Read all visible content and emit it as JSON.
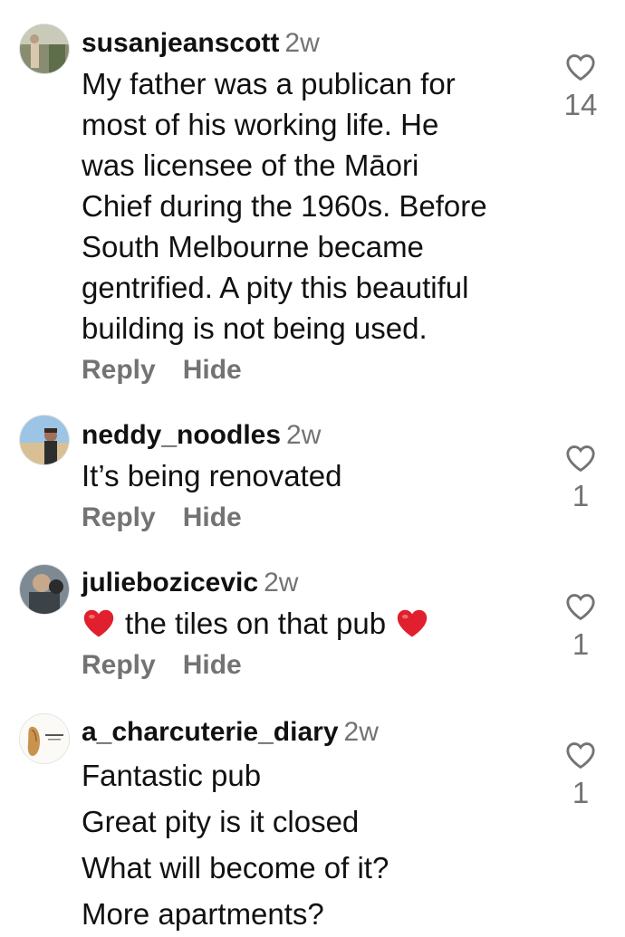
{
  "comments": [
    {
      "username": "susanjeanscott",
      "time": "2w",
      "lines": [
        "My father was a publican for",
        "most of his working life. He",
        "was licensee of the Māori",
        "Chief during the 1960s. Before",
        "South Melbourne became",
        "gentrified. A pity this beautiful",
        "building is not being used."
      ],
      "reply_label": "Reply",
      "hide_label": "Hide",
      "likes": "14"
    },
    {
      "username": "neddy_noodles",
      "time": "2w",
      "lines": [
        "It’s being renovated"
      ],
      "reply_label": "Reply",
      "hide_label": "Hide",
      "likes": "1"
    },
    {
      "username": "juliebozicevic",
      "time": "2w",
      "text": "the tiles on that pub",
      "emoji": "red-heart",
      "reply_label": "Reply",
      "hide_label": "Hide",
      "likes": "1"
    },
    {
      "username": "a_charcuterie_diary",
      "time": "2w",
      "lines": [
        "Fantastic pub",
        "Great pity is it closed",
        "What will become of it?",
        "More apartments?"
      ],
      "likes": "1"
    }
  ],
  "colors": {
    "text": "#111111",
    "secondary": "#737373",
    "emoji_heart": "#e0202e",
    "background": "#ffffff"
  },
  "icons": {
    "like": "heart-outline-icon",
    "emoji": "red-heart-emoji"
  }
}
